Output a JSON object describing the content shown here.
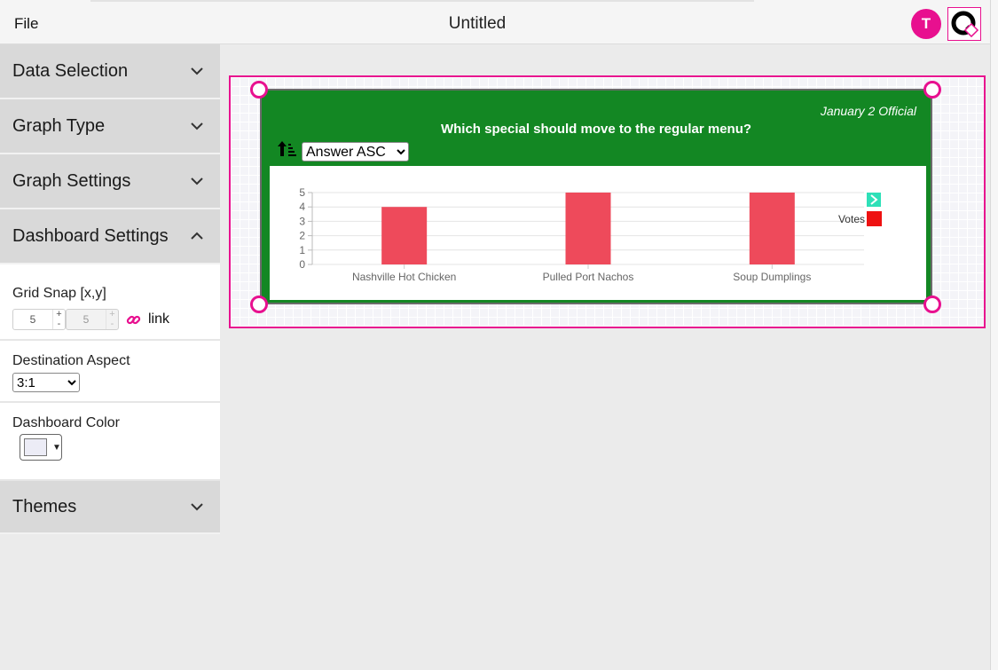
{
  "topbar": {
    "file_menu": "File",
    "title": "Untitled",
    "avatar_initial": "T"
  },
  "sidebar": {
    "sections": {
      "data_selection": "Data Selection",
      "graph_type": "Graph Type",
      "graph_settings": "Graph Settings",
      "dashboard_settings": "Dashboard Settings",
      "themes": "Themes"
    },
    "dashboard_settings": {
      "grid_snap_label": "Grid Snap [x,y]",
      "grid_snap_x": "5",
      "grid_snap_y": "5",
      "spin_plus": "+",
      "spin_minus": "-",
      "link_label": "link",
      "destination_aspect_label": "Destination Aspect",
      "destination_aspect_value": "3:1",
      "dashboard_color_label": "Dashboard Color",
      "dashboard_color": "#ececf6"
    }
  },
  "widget": {
    "date_label": "January 2 Official",
    "question": "Which special should move to the regular menu?",
    "sort_value": "Answer ASC",
    "background_color": "#138723"
  },
  "colors": {
    "accent": "#e8108f",
    "bar": "#ee4a5b",
    "legend_swatch": "#ee1111",
    "legend_arrow": "#2ee0b8"
  },
  "chart_data": {
    "type": "bar",
    "categories": [
      "Nashville Hot Chicken",
      "Pulled Port Nachos",
      "Soup Dumplings"
    ],
    "series": [
      {
        "name": "Votes",
        "values": [
          4,
          5,
          5
        ]
      }
    ],
    "yticks": [
      "0",
      "1",
      "2",
      "3",
      "4",
      "5"
    ],
    "ylim": [
      0,
      5
    ],
    "grid": true,
    "legend_position": "right"
  }
}
